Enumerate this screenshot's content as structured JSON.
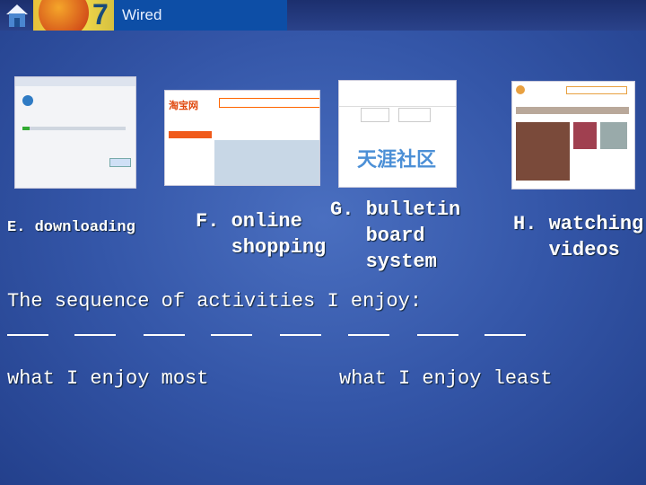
{
  "header": {
    "logo_text": "Wired",
    "home_icon": "home-icon"
  },
  "images": [
    {
      "caption": "E. downloading",
      "icon": "download-dialog-screenshot"
    },
    {
      "caption": "F. online\n   shopping",
      "icon": "taobao-website-screenshot"
    },
    {
      "caption": "G. bulletin\n   board\n   system",
      "icon": "tianya-forum-screenshot"
    },
    {
      "caption": "H. watching\n   videos",
      "icon": "video-website-screenshot"
    }
  ],
  "sequence_prompt": "The sequence of activities I enjoy:",
  "blank_count": 8,
  "most_label": "what I enjoy most",
  "least_label": "what I enjoy least",
  "colors": {
    "background": "#3456a8",
    "header_band": "#0d4ea6"
  }
}
